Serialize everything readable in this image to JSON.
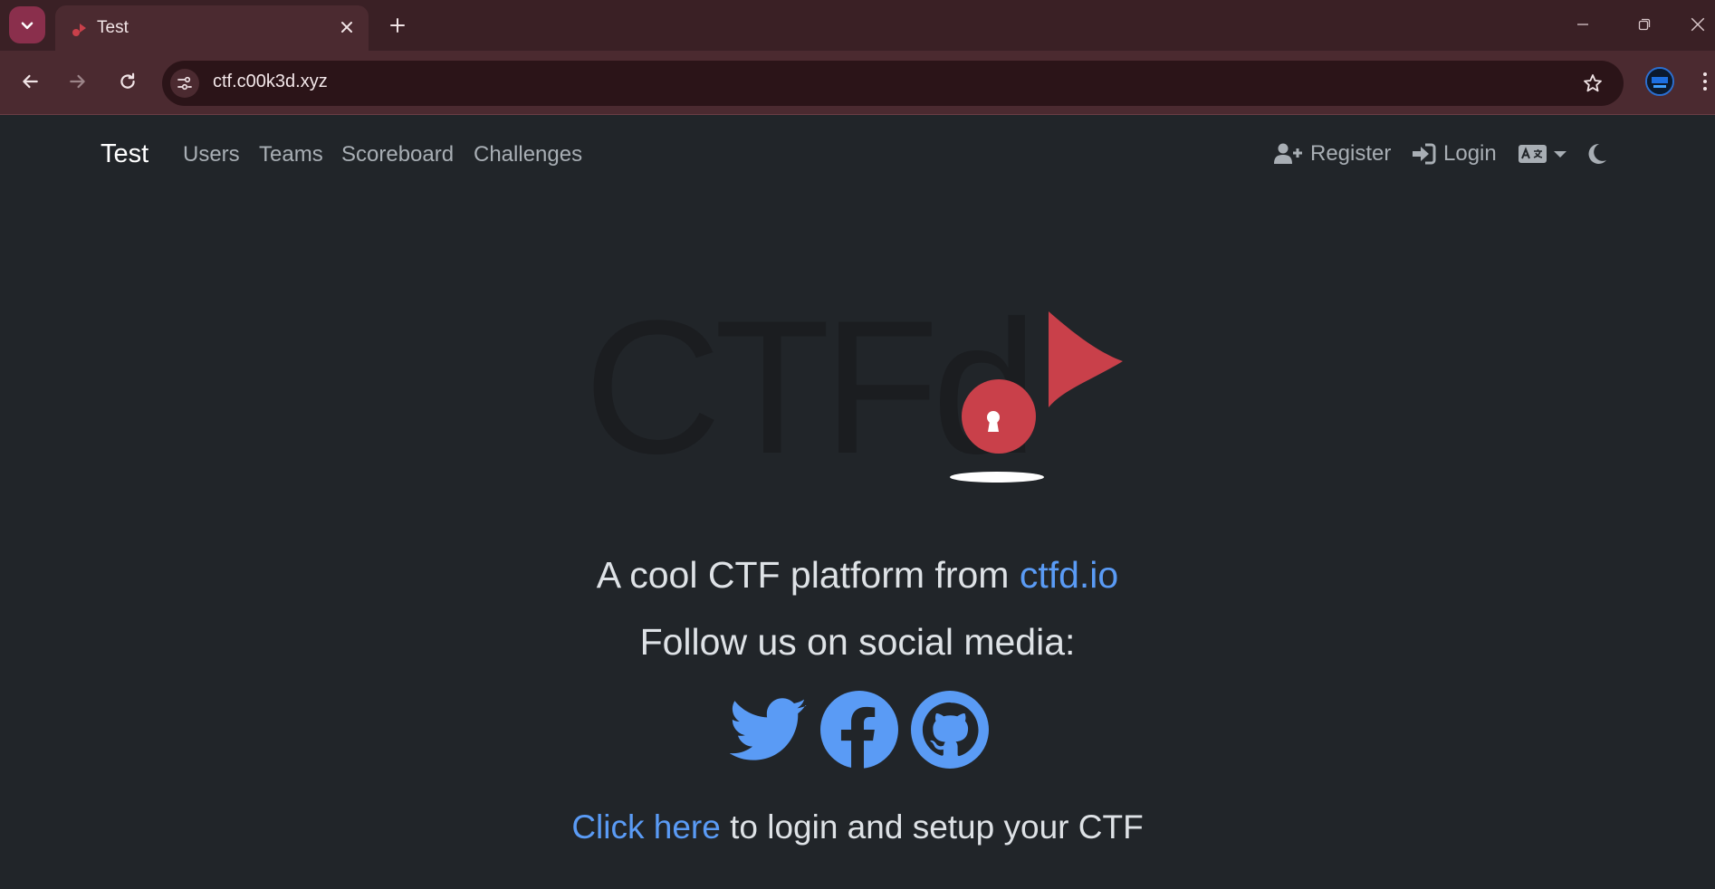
{
  "browser": {
    "tab_title": "Test",
    "url": "ctf.c00k3d.xyz"
  },
  "navbar": {
    "brand": "Test",
    "links": [
      "Users",
      "Teams",
      "Scoreboard",
      "Challenges"
    ],
    "register_label": "Register",
    "login_label": "Login"
  },
  "main": {
    "logo_text": "CTFd",
    "tagline_prefix": "A cool CTF platform from ",
    "tagline_link": "ctfd.io",
    "follow_text": "Follow us on social media:",
    "setup_link": "Click here",
    "setup_suffix": " to login and setup your CTF"
  },
  "colors": {
    "page_bg": "#212529",
    "link": "#5a9bf5",
    "flag_red": "#c9404a",
    "browser_frame": "#4b2a30"
  },
  "icons": [
    "chevron-down-icon",
    "close-icon",
    "plus-icon",
    "back-icon",
    "forward-icon",
    "reload-icon",
    "site-info-icon",
    "star-icon",
    "kebab-menu-icon",
    "user-plus-icon",
    "sign-in-icon",
    "language-icon",
    "moon-icon",
    "twitter-icon",
    "facebook-icon",
    "github-icon"
  ]
}
